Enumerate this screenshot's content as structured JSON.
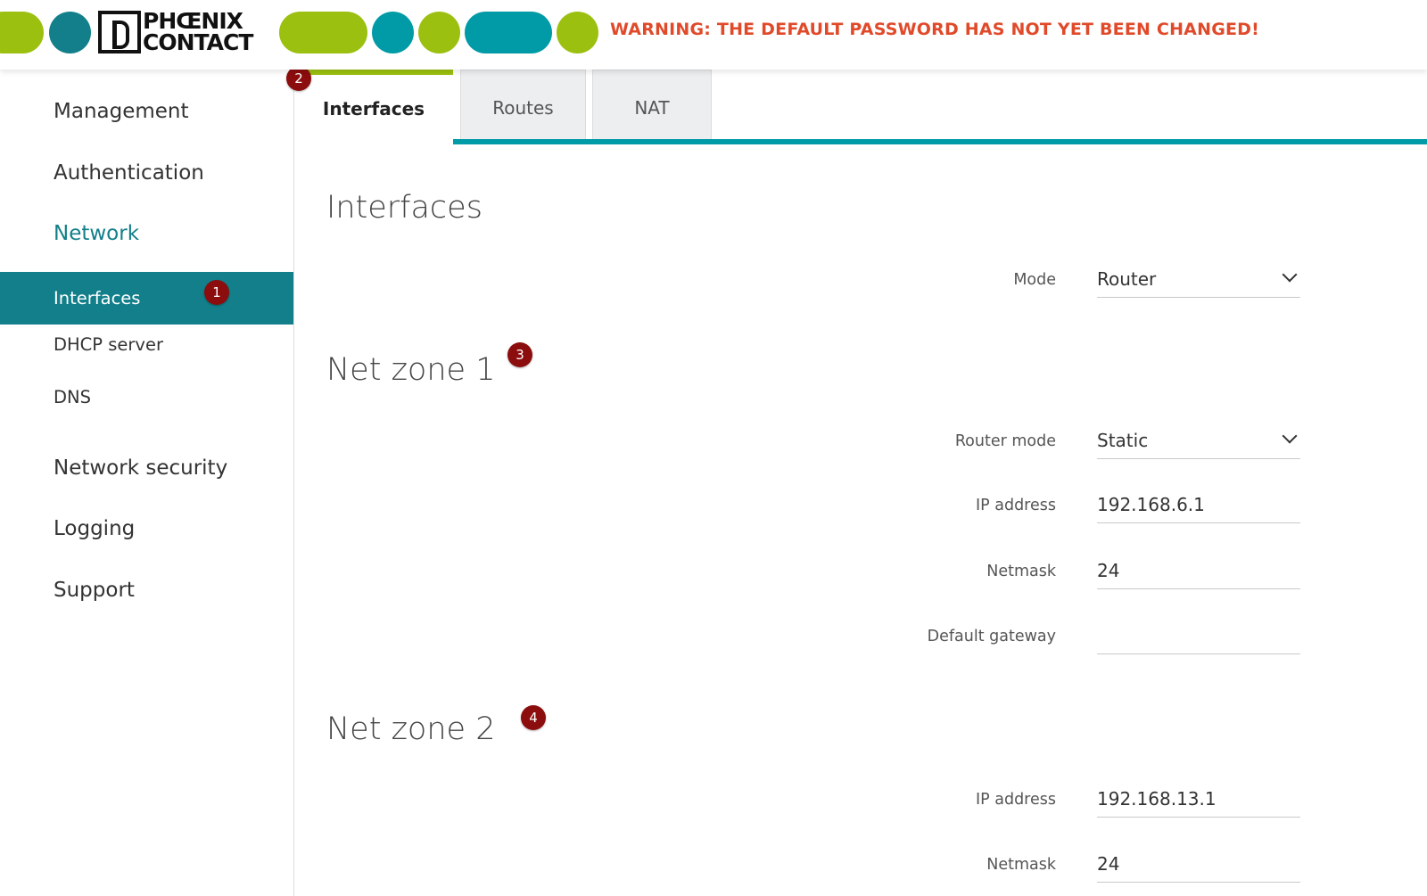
{
  "header": {
    "brand_line1": "PHŒNIX",
    "brand_line2": "CONTACT",
    "warning": "WARNING: THE DEFAULT PASSWORD HAS NOT YET BEEN CHANGED!",
    "colors": {
      "green": "#9bc00f",
      "teal": "#009ba6",
      "dark_teal": "#127f8a",
      "warning": "#e04a2a"
    }
  },
  "sidebar": {
    "items": [
      {
        "label": "Management"
      },
      {
        "label": "Authentication"
      },
      {
        "label": "Network"
      },
      {
        "label": "Interfaces"
      },
      {
        "label": "DHCP server"
      },
      {
        "label": "DNS"
      },
      {
        "label": "Network security"
      },
      {
        "label": "Logging"
      },
      {
        "label": "Support"
      }
    ],
    "active": "Interfaces"
  },
  "tabs": [
    {
      "label": "Interfaces",
      "active": true
    },
    {
      "label": "Routes",
      "active": false
    },
    {
      "label": "NAT",
      "active": false
    }
  ],
  "badges": [
    "1",
    "2",
    "3",
    "4"
  ],
  "main": {
    "title": "Interfaces",
    "mode": {
      "label": "Mode",
      "value": "Router"
    },
    "zone1": {
      "title": "Net zone 1",
      "router_mode": {
        "label": "Router mode",
        "value": "Static"
      },
      "ip": {
        "label": "IP address",
        "value": "192.168.6.1"
      },
      "netmask": {
        "label": "Netmask",
        "value": "24"
      },
      "gateway": {
        "label": "Default gateway",
        "value": ""
      }
    },
    "zone2": {
      "title": "Net zone 2",
      "ip": {
        "label": "IP address",
        "value": "192.168.13.1"
      },
      "netmask": {
        "label": "Netmask",
        "value": "24"
      }
    }
  }
}
